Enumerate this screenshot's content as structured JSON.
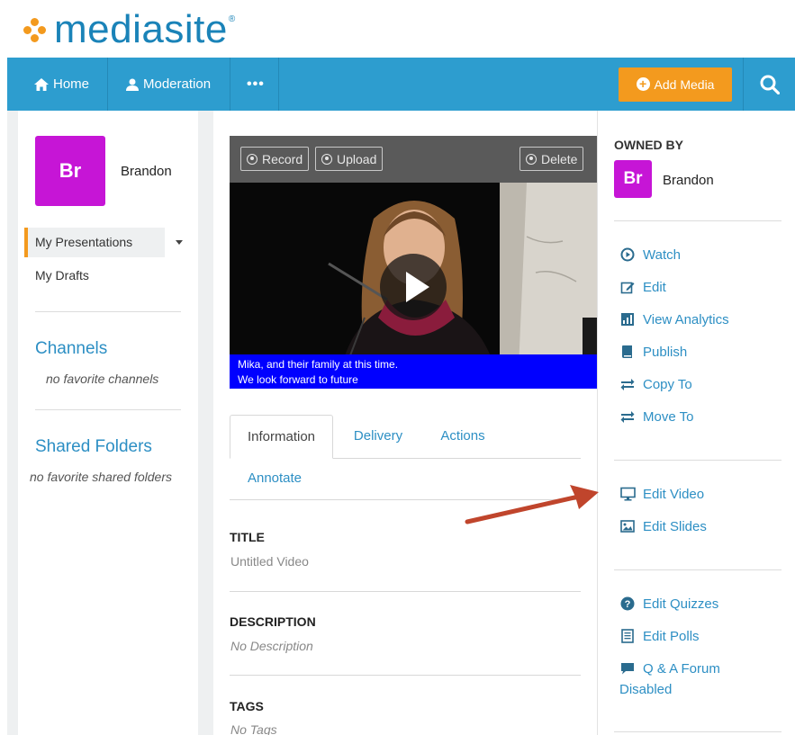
{
  "brand": {
    "logo_text": "mediasite",
    "trademark": "®",
    "dot_color": "#f39a1e",
    "text_color": "#1a83b8"
  },
  "navbar": {
    "color": "#2d9dcf",
    "items": [
      {
        "label": "Home",
        "icon": "home-icon"
      },
      {
        "label": "Moderation",
        "icon": "user-icon"
      },
      {
        "label": "•••",
        "icon": "more-icon"
      }
    ],
    "add_media_label": "Add Media",
    "add_media_color": "#f39a1e",
    "search_icon": "search-icon"
  },
  "sidebar": {
    "user_initials": "Br",
    "user_name": "Brandon",
    "avatar_color": "#c615d6",
    "nav": [
      {
        "label": "My Presentations",
        "active": true
      },
      {
        "label": "My Drafts",
        "active": false
      }
    ],
    "channels_heading": "Channels",
    "channels_empty": "no favorite channels",
    "folders_heading": "Shared Folders",
    "folders_empty": "no favorite shared folders"
  },
  "video": {
    "buttons": {
      "record": "Record",
      "upload": "Upload",
      "delete": "Delete"
    },
    "caption_line1": "Mika, and their family at this time.",
    "caption_line2": "We look forward to future"
  },
  "tabs": [
    {
      "label": "Information",
      "active": true
    },
    {
      "label": "Delivery",
      "active": false
    },
    {
      "label": "Actions",
      "active": false
    },
    {
      "label": "Annotate",
      "active": false
    }
  ],
  "details": {
    "title_label": "TITLE",
    "title_value": "Untitled Video",
    "description_label": "DESCRIPTION",
    "description_value": "No Description",
    "tags_label": "TAGS",
    "tags_value": "No Tags"
  },
  "right_panel": {
    "owned_by_label": "OWNED BY",
    "owner_initials": "Br",
    "owner_name": "Brandon",
    "actions_group1": [
      {
        "label": "Watch",
        "icon": "play-circle-icon"
      },
      {
        "label": "Edit",
        "icon": "pencil-square-icon"
      },
      {
        "label": "View Analytics",
        "icon": "analytics-icon"
      },
      {
        "label": "Publish",
        "icon": "book-icon"
      },
      {
        "label": "Copy To",
        "icon": "exchange-icon"
      },
      {
        "label": "Move To",
        "icon": "exchange-icon"
      }
    ],
    "actions_group2": [
      {
        "label": "Edit Video",
        "icon": "monitor-icon"
      },
      {
        "label": "Edit Slides",
        "icon": "image-icon"
      }
    ],
    "actions_group3": [
      {
        "label": "Edit Quizzes",
        "icon": "question-circle-icon"
      },
      {
        "label": "Edit Polls",
        "icon": "list-icon"
      },
      {
        "label": "Q & A Forum",
        "icon": "comment-icon"
      }
    ],
    "qa_status": "Disabled",
    "link_color": "#2d8fc4",
    "annotation_arrow_color": "#c0452c"
  }
}
